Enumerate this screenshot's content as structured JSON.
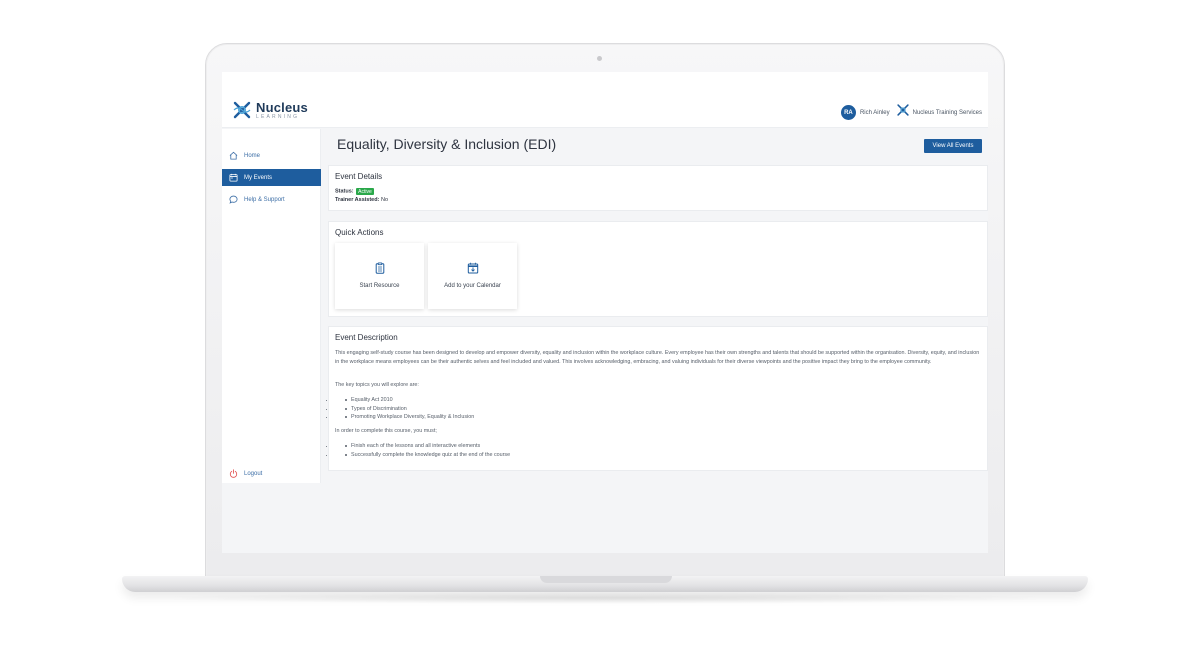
{
  "header": {
    "logo_title": "Nucleus",
    "logo_subtitle": "LEARNING",
    "user_initials": "RA",
    "user_name": "Rich Ainley",
    "org_name": "Nucleus Training Services"
  },
  "sidebar": {
    "items": [
      {
        "label": "Home",
        "icon": "home-icon"
      },
      {
        "label": "My Events",
        "icon": "calendar-icon",
        "active": true
      },
      {
        "label": "Help & Support",
        "icon": "chat-bubble-icon"
      }
    ],
    "logout_label": "Logout"
  },
  "main": {
    "title": "Equality, Diversity & Inclusion (EDI)",
    "view_all_label": "View All Events",
    "event_details": {
      "title": "Event Details",
      "status_label": "Status:",
      "status_value": "Active",
      "trainer_label": "Trainer Assisted:",
      "trainer_value": "No"
    },
    "quick_actions": {
      "title": "Quick Actions",
      "items": [
        {
          "label": "Start Resource",
          "icon": "clipboard-icon"
        },
        {
          "label": "Add to your Calendar",
          "icon": "calendar-download-icon"
        }
      ]
    },
    "description": {
      "title": "Event Description",
      "intro": "This engaging self-study course has been designed to develop and empower diversity, equality and inclusion within the workplace culture. Every employee has their own strengths and talents that should be supported within the organisation. Diversity, equity, and inclusion in the workplace means employees can be their authentic selves and feel included and valued. This involves acknowledging, embracing, and valuing individuals for their diverse viewpoints and the positive impact they bring to the employee community.",
      "topics_heading": "The key topics you will explore are:",
      "topics": [
        "Equality Act 2010",
        "Types of Discrimination",
        "Promoting Workplace Diversity, Equality & Inclusion"
      ],
      "complete_heading": "In order to complete this course, you must;",
      "requirements": [
        "Finish each of the lessons and all interactive elements",
        "Successfully complete the knowledge quiz at the end of the course"
      ]
    }
  },
  "colors": {
    "primary": "#1e5d9e",
    "status_active": "#2aa84a",
    "logout_icon": "#e04848"
  }
}
